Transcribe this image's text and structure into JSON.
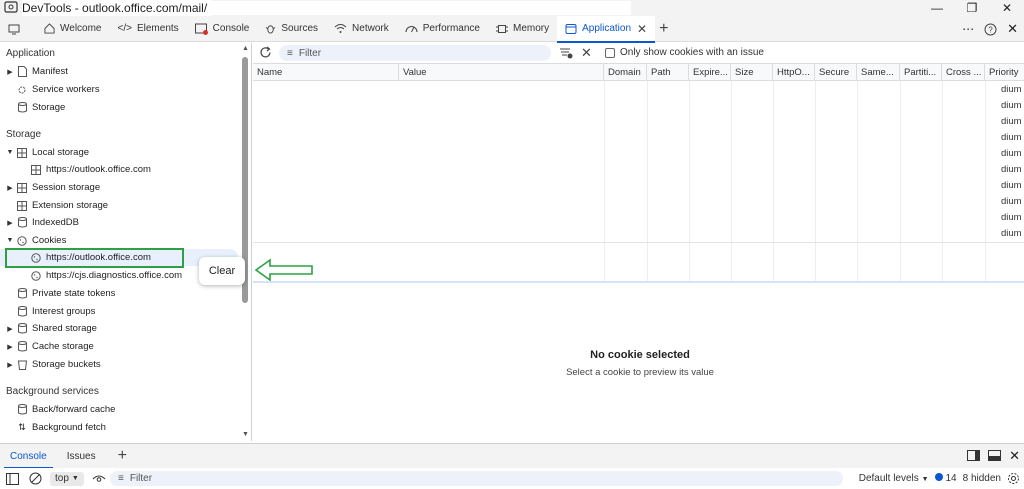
{
  "window": {
    "title": "DevTools - outlook.office.com/mail/"
  },
  "tabs": [
    {
      "label": "Welcome"
    },
    {
      "label": "Elements"
    },
    {
      "label": "Console"
    },
    {
      "label": "Sources"
    },
    {
      "label": "Network"
    },
    {
      "label": "Performance"
    },
    {
      "label": "Memory"
    },
    {
      "label": "Application"
    }
  ],
  "sidebar": {
    "section_application": "Application",
    "application_items": [
      "Manifest",
      "Service workers",
      "Storage"
    ],
    "section_storage": "Storage",
    "storage_items": {
      "local_storage": "Local storage",
      "local_storage_origin": "https://outlook.office.com",
      "session_storage": "Session storage",
      "extension_storage": "Extension storage",
      "indexeddb": "IndexedDB",
      "cookies": "Cookies",
      "cookie_origin_1": "https://outlook.office.com",
      "cookie_origin_2": "https://cjs.diagnostics.office.com",
      "private_state_tokens": "Private state tokens",
      "interest_groups": "Interest groups",
      "shared_storage": "Shared storage",
      "cache_storage": "Cache storage",
      "storage_buckets": "Storage buckets"
    },
    "section_background": "Background services",
    "background_items": [
      "Back/forward cache",
      "Background fetch"
    ]
  },
  "tooltip": {
    "label": "Clear"
  },
  "toolbar": {
    "filter_placeholder": "Filter",
    "only_issues_label": "Only show cookies with an issue"
  },
  "table": {
    "columns": [
      "Name",
      "Value",
      "Domain",
      "Path",
      "Expire...",
      "Size",
      "HttpO...",
      "Secure",
      "Same...",
      "Partiti...",
      "Cross ...",
      "Priority"
    ],
    "priority_cells": [
      "dium",
      "dium",
      "dium",
      "dium",
      "dium",
      "dium",
      "dium",
      "dium",
      "dium",
      "dium"
    ]
  },
  "preview": {
    "title": "No cookie selected",
    "subtitle": "Select a cookie to preview its value"
  },
  "drawer": {
    "tabs": [
      "Console",
      "Issues"
    ],
    "context": "top",
    "filter_placeholder": "Filter",
    "levels": "Default levels",
    "issue_count": "14",
    "hidden": "8 hidden"
  },
  "colors": {
    "accent": "#0b57d0",
    "highlight": "#2ea043",
    "badge_red": "#d93025"
  }
}
